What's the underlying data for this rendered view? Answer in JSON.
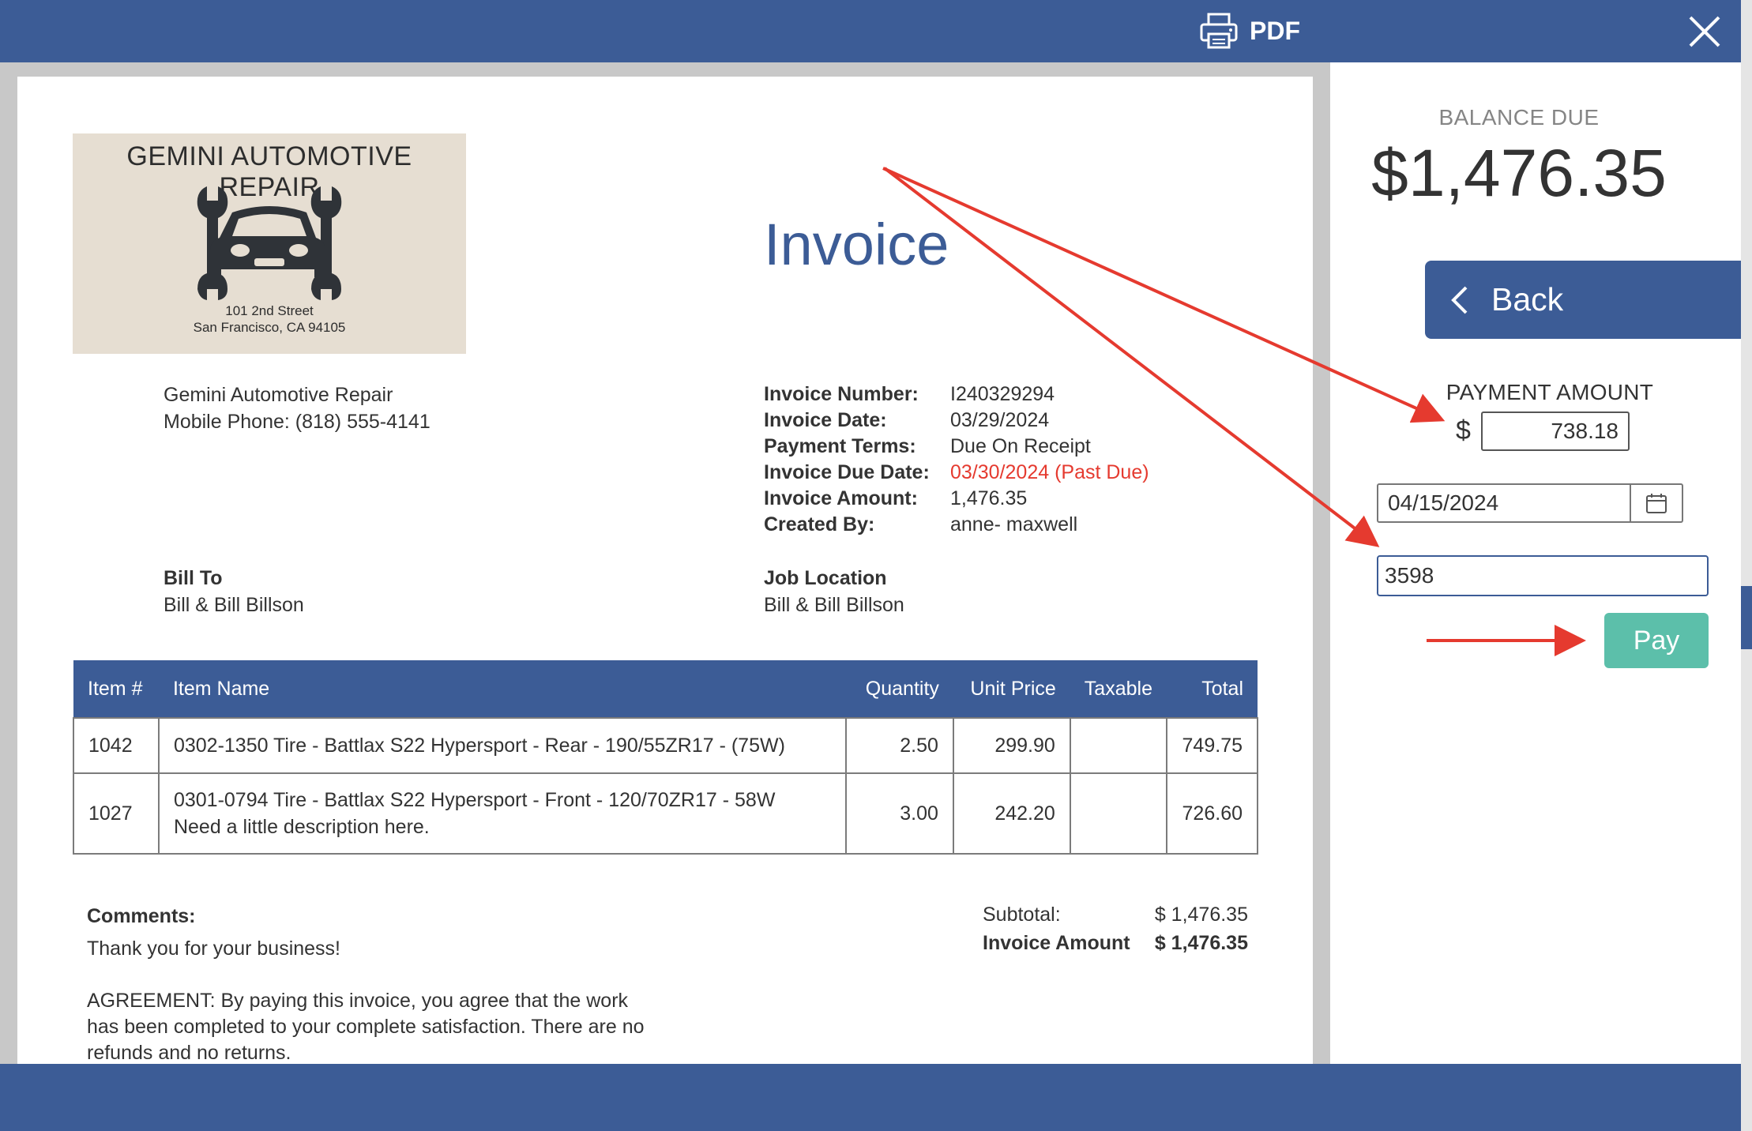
{
  "toolbar": {
    "pdf_label": "PDF"
  },
  "logo": {
    "title": "GEMINI AUTOMOTIVE REPAIR",
    "address_line1": "101 2nd Street",
    "address_line2": "San Francisco, CA  94105"
  },
  "invoice_heading": "Invoice",
  "company": {
    "name": "Gemini Automotive Repair",
    "phone": "Mobile Phone: (818) 555-4141"
  },
  "meta": [
    {
      "label": "Invoice Number:",
      "value": "I240329294"
    },
    {
      "label": "Invoice Date:",
      "value": "03/29/2024"
    },
    {
      "label": "Payment Terms:",
      "value": "Due On Receipt"
    },
    {
      "label": "Invoice Due Date:",
      "value": "03/30/2024 (Past Due)"
    },
    {
      "label": "Invoice Amount:",
      "value": "1,476.35"
    },
    {
      "label": "Created By:",
      "value": "anne- maxwell"
    }
  ],
  "bill_to": {
    "label": "Bill To",
    "name": "Bill & Bill Billson"
  },
  "job_location": {
    "label": "Job Location",
    "name": "Bill & Bill Billson"
  },
  "table": {
    "headers": [
      "Item #",
      "Item Name",
      "Quantity",
      "Unit Price",
      "Taxable",
      "Total"
    ],
    "rows": [
      {
        "item": "1042",
        "name": "0302-1350 Tire - Battlax S22 Hypersport - Rear - 190/55ZR17 - (75W)",
        "desc": "",
        "quantity": "2.50",
        "unit_price": "299.90",
        "taxable": "",
        "total": "749.75"
      },
      {
        "item": "1027",
        "name": "0301-0794 Tire - Battlax S22 Hypersport - Front - 120/70ZR17 - 58W",
        "desc": "Need a little description here.",
        "quantity": "3.00",
        "unit_price": "242.20",
        "taxable": "",
        "total": "726.60"
      }
    ]
  },
  "comments": {
    "label": "Comments:",
    "text": "Thank you for your business!",
    "agreement": "AGREEMENT: By paying this invoice, you agree that the work has been completed to your complete satisfaction. There are no refunds and no returns."
  },
  "totals": {
    "subtotal_label": "Subtotal:",
    "subtotal_value": "$ 1,476.35",
    "amount_label": "Invoice Amount",
    "amount_value": "$ 1,476.35"
  },
  "panel": {
    "balance_label": "BALANCE DUE",
    "balance_value": "$1,476.35",
    "back_label": "Back",
    "payment_amount_label": "PAYMENT AMOUNT",
    "currency": "$",
    "payment_amount": "738.18",
    "payment_date": "04/15/2024",
    "reference": "3598",
    "pay_label": "Pay"
  },
  "colors": {
    "brand_blue": "#3c5c96",
    "pay_green": "#5cbfaa",
    "past_due_red": "#e53a2f",
    "annotation_arrow": "#e53a2f"
  }
}
